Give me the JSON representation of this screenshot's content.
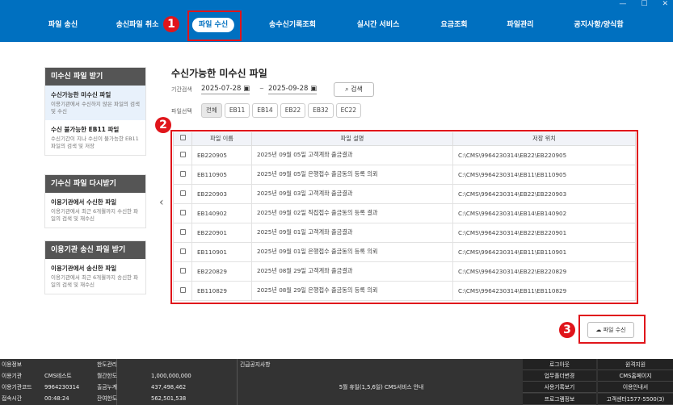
{
  "window": {
    "minimize": "—",
    "maximize": "☐",
    "close": "✕"
  },
  "nav": [
    "파일 송신",
    "송신파일 취소",
    "파일 수신",
    "송수신기록조회",
    "실시간 서비스",
    "요금조회",
    "파일관리",
    "공지사항/양식함"
  ],
  "nav_active": "파일 수신",
  "badges": [
    "1",
    "2",
    "3"
  ],
  "sidebar": [
    {
      "header": "미수신 파일 받기",
      "items": [
        {
          "title": "수신가능한 미수신 파일",
          "desc": "이용기관에서 수신하지 않은 파일의 검색 및 수신",
          "selected": true
        },
        {
          "title": "수신 불가능한 EB11 파일",
          "desc": "수신기간이 지나 수신이 불가능한 EB11 파일의 검색 및 저장"
        }
      ]
    },
    {
      "header": "기수신 파일 다시받기",
      "items": [
        {
          "title": "이용기관에서 수신한 파일",
          "desc": "이용기관에서 최근 6개월까지 수신한 파일의 검색 및 재수신"
        }
      ]
    },
    {
      "header": "이용기관 송신 파일 받기",
      "items": [
        {
          "title": "이용기관에서 송신한 파일",
          "desc": "이용기관에서 최근 6개월까지 송신한 파일의 검색 및 재수신"
        }
      ]
    }
  ],
  "main": {
    "title": "수신가능한 미수신 파일",
    "period_label": "기간검색",
    "date_from": "2025-07-28",
    "date_sep": "~",
    "date_to": "2025-09-28",
    "search_label": "검색",
    "file_select_label": "파일선택",
    "chips": [
      "전체",
      "EB11",
      "EB14",
      "EB22",
      "EB32",
      "EC22"
    ],
    "chip_active": "전체",
    "columns": [
      "파일 이름",
      "파일 설명",
      "저장 위치"
    ],
    "rows": [
      [
        "EB220905",
        "2025년 09월 05일 고객계좌 출금결과",
        "C:\\CMS\\9964230314\\EB22\\EB220905"
      ],
      [
        "EB110905",
        "2025년 09월 05일 은행접수 출금동의 등록 의뢰",
        "C:\\CMS\\9964230314\\EB11\\EB110905"
      ],
      [
        "EB220903",
        "2025년 09월 03일 고객계좌 출금결과",
        "C:\\CMS\\9964230314\\EB22\\EB220903"
      ],
      [
        "EB140902",
        "2025년 09월 02일 직접접수 출금동의 등록 결과",
        "C:\\CMS\\9964230314\\EB14\\EB140902"
      ],
      [
        "EB220901",
        "2025년 09월 01일 고객계좌 출금결과",
        "C:\\CMS\\9964230314\\EB22\\EB220901"
      ],
      [
        "EB110901",
        "2025년 09월 01일 은행접수 출금동의 등록 의뢰",
        "C:\\CMS\\9964230314\\EB11\\EB110901"
      ],
      [
        "EB220829",
        "2025년 08월 29일 고객계좌 출금결과",
        "C:\\CMS\\9964230314\\EB22\\EB220829"
      ],
      [
        "EB110829",
        "2025년 08월 29일 은행접수 출금동의 등록 의뢰",
        "C:\\CMS\\9964230314\\EB11\\EB110829"
      ]
    ],
    "receive_button": "파일 수신"
  },
  "footer": {
    "info_header": "이용정보",
    "info": [
      [
        "이용기관",
        "CMS테스트"
      ],
      [
        "이용기관코드",
        "9964230314"
      ],
      [
        "접속시간",
        "00:48:24"
      ]
    ],
    "limit_header": "한도관리",
    "limits": [
      [
        "월간한도",
        "1,000,000,000"
      ],
      [
        "출금누계",
        "437,498,462"
      ],
      [
        "잔여한도",
        "562,501,538"
      ]
    ],
    "notice_header": "긴급공지사항",
    "notice": "5월 휴일(1,5,6일) CMS서비스 안내",
    "buttons": [
      "로그아웃",
      "원격지원",
      "업무폴더변경",
      "CMS홈페이지",
      "사용기록보기",
      "이용안내서",
      "프로그램정보",
      "고객센터1577-5500(3)"
    ]
  },
  "colors": {
    "brand": "#0070c0",
    "highlight": "#e0151b",
    "footer": "#333333"
  }
}
